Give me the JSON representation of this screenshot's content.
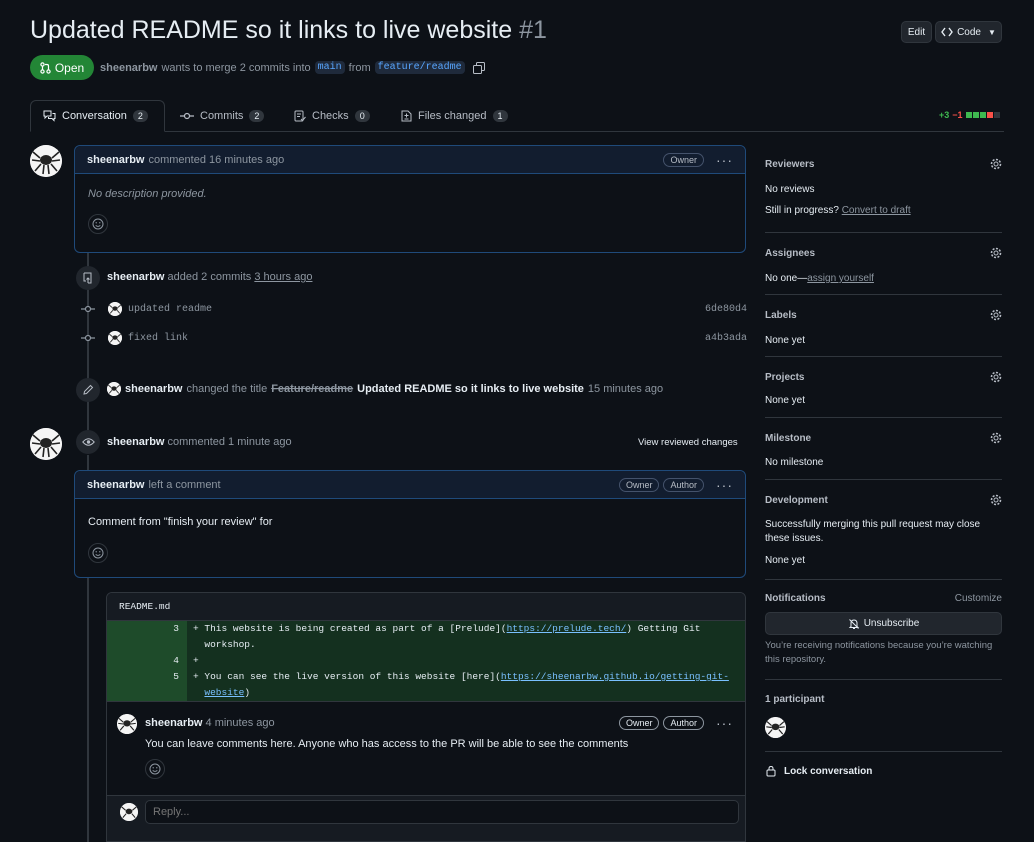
{
  "pr": {
    "title": "Updated README so it links to live website",
    "number": "#1",
    "state": "Open",
    "author": "sheenarbw",
    "merge_text": "wants to merge 2 commits into",
    "base_branch": "main",
    "from_text": "from",
    "head_branch": "feature/readme"
  },
  "toolbar": {
    "edit_label": "Edit",
    "code_label": "Code"
  },
  "tabs": [
    {
      "label": "Conversation",
      "count": "2"
    },
    {
      "label": "Commits",
      "count": "2"
    },
    {
      "label": "Checks",
      "count": "0"
    },
    {
      "label": "Files changed",
      "count": "1"
    }
  ],
  "diffstat": {
    "additions": "+3",
    "deletions": "−1"
  },
  "first_comment": {
    "author": "sheenarbw",
    "action": "commented 16 minutes ago",
    "badge": "Owner",
    "body": "No description provided."
  },
  "commits_event": {
    "author": "sheenarbw",
    "action": "added 2 commits",
    "time": "3 hours ago",
    "commits": [
      {
        "message": "updated readme",
        "sha": "6de80d4"
      },
      {
        "message": "fixed link",
        "sha": "a4b3ada"
      }
    ]
  },
  "rename_event": {
    "author": "sheenarbw",
    "action": "changed the title",
    "old_title": "Feature/readme",
    "new_title": "Updated README so it links to live website",
    "time": "15 minutes ago"
  },
  "review_event": {
    "author": "sheenarbw",
    "action": "commented 1 minute ago",
    "link": "View reviewed changes"
  },
  "review_comment": {
    "author": "sheenarbw",
    "action": "left a comment",
    "badges": [
      "Owner",
      "Author"
    ],
    "body": "Comment from \"finish your review\" for"
  },
  "diff": {
    "file": "README.md",
    "lines": [
      {
        "num": "3",
        "text": "+ This website is being created as part of a [Prelude](",
        "link": "https://prelude.tech/",
        "rest": ") Getting Git"
      },
      {
        "num": "",
        "text": "  workshop.",
        "link": "",
        "rest": ""
      },
      {
        "num": "4",
        "text": "+",
        "link": "",
        "rest": ""
      },
      {
        "num": "5",
        "text": "+ You can see the live version of this website [here](",
        "link": "https://sheenarbw.github.io/getting-git-",
        "rest": ""
      },
      {
        "num": "",
        "text": "  ",
        "link": "website",
        "rest": ")"
      }
    ]
  },
  "thread_comment": {
    "author": "sheenarbw",
    "time": "4 minutes ago",
    "badges": [
      "Owner",
      "Author"
    ],
    "body": "You can leave comments here. Anyone who has access to the PR will be able to see the comments"
  },
  "reply": {
    "placeholder": "Reply..."
  },
  "sidebar": {
    "reviewers": {
      "heading": "Reviewers",
      "value": "No reviews",
      "progress_text": "Still in progress?",
      "progress_link": "Convert to draft"
    },
    "assignees": {
      "heading": "Assignees",
      "value": "No one—",
      "link": "assign yourself"
    },
    "labels": {
      "heading": "Labels",
      "value": "None yet"
    },
    "projects": {
      "heading": "Projects",
      "value": "None yet"
    },
    "milestone": {
      "heading": "Milestone",
      "value": "No milestone"
    },
    "development": {
      "heading": "Development",
      "text": "Successfully merging this pull request may close these issues.",
      "value": "None yet"
    },
    "notifications": {
      "heading": "Notifications",
      "customize": "Customize",
      "button": "Unsubscribe",
      "text": "You’re receiving notifications because you’re watching this repository."
    },
    "participants": {
      "heading": "1 participant"
    },
    "lock": {
      "label": "Lock conversation"
    }
  },
  "colors": {
    "accent": "#238636",
    "link": "#58a6ff",
    "border_blue": "#1f4a7a"
  }
}
